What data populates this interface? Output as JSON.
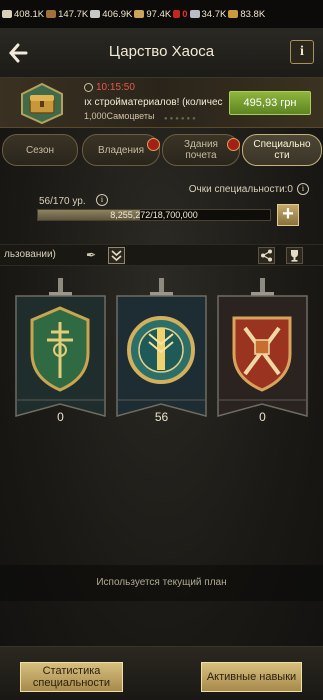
{
  "resources": [
    {
      "value": "408.1K",
      "icon": "food-icon",
      "color": "#d9d0b8"
    },
    {
      "value": "147.7K",
      "icon": "wood-icon",
      "color": "#a0703b"
    },
    {
      "value": "406.9K",
      "icon": "stone-icon",
      "color": "#c8c8c8"
    },
    {
      "value": "97.4K",
      "icon": "iron-icon",
      "color": "#c9a45a"
    },
    {
      "value": "0",
      "icon": "blood-icon",
      "color": "#c3261c"
    },
    {
      "value": "34.7K",
      "icon": "silver-icon",
      "color": "#b8bcc4"
    },
    {
      "value": "83.8K",
      "icon": "gold-icon",
      "color": "#c99a3c"
    }
  ],
  "header": {
    "title": "Царство Хаоса",
    "info_label": "i"
  },
  "offer": {
    "timer": "10:15:50",
    "text": "ıx стройматериалов! (количес",
    "subtext": "1,000Самоцветы",
    "price": "495,93 грн"
  },
  "tabs": [
    {
      "label": "Сезон"
    },
    {
      "label": "Владения"
    },
    {
      "label": "Здания почета"
    },
    {
      "label": "Специально сти"
    }
  ],
  "specialty": {
    "points_label": "Очки специальности:0",
    "level_label": "56/170 ур.",
    "progress_text": "8,255,272/18,700,000",
    "progress_fraction": 0.4415
  },
  "plan": {
    "name": "льзовании)",
    "status": "Используется текущий план"
  },
  "branches": [
    {
      "value": "0"
    },
    {
      "value": "56"
    },
    {
      "value": "0"
    }
  ],
  "buttons": {
    "stats": "Статистика специальности",
    "active": "Активные навыки"
  }
}
